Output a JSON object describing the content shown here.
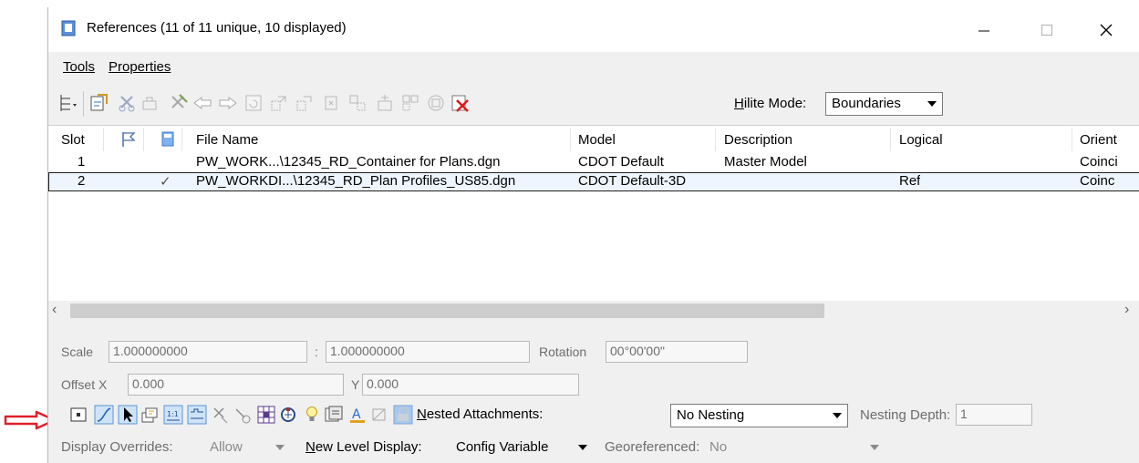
{
  "window": {
    "title": "References (11 of 11 unique, 10 displayed)"
  },
  "caption_buttons": {
    "minimize": "—",
    "maximize": "☐",
    "close": "✕"
  },
  "menubar": {
    "tools": "Tools",
    "properties": "Properties"
  },
  "toolbar": {
    "hilite_label": "Hilite Mode:",
    "hilite_value": "Boundaries"
  },
  "table": {
    "columns": [
      "Slot",
      "",
      "",
      "File Name",
      "Model",
      "Description",
      "Logical",
      "Orient"
    ],
    "rows": [
      {
        "slot": "1",
        "check": "",
        "file": "PW_WORK...\\12345_RD_Container for Plans.dgn",
        "model": "CDOT Default",
        "description": "Master Model",
        "logical": "",
        "orient": "Coinci"
      },
      {
        "slot": "2",
        "check": "✓",
        "file": "PW_WORKDI...\\12345_RD_Plan Profiles_US85.dgn",
        "model": "CDOT Default-3D",
        "description": "",
        "logical": "Ref",
        "orient": "Coinc"
      }
    ]
  },
  "scrollbar": {
    "left": "‹",
    "right": "›"
  },
  "props": {
    "scale_label": "Scale",
    "scale_value1": "1.000000000",
    "colon": ":",
    "scale_value2": "1.000000000",
    "rotation_label": "Rotation",
    "rotation_value": "00°00'00\"",
    "offsetx_label": "Offset X",
    "offsetx_value": "0.000",
    "y_label": "Y",
    "y_value": "0.000"
  },
  "nesting": {
    "label": "Nested Attachments:",
    "value": "No Nesting",
    "depth_label": "Nesting Depth:",
    "depth_value": "1"
  },
  "bottom_row": {
    "display_overrides_label": "Display Overrides:",
    "display_overrides_value": "Allow",
    "new_level_label": "New Level Display:",
    "new_level_value": "Config Variable",
    "georef_label": "Georeferenced:",
    "georef_value": "No"
  },
  "top_fragment": "_                          _",
  "colors": {
    "accent": "#2f6fd0",
    "arrow": "#e0202a",
    "selection_border": "#1f1f1f"
  }
}
